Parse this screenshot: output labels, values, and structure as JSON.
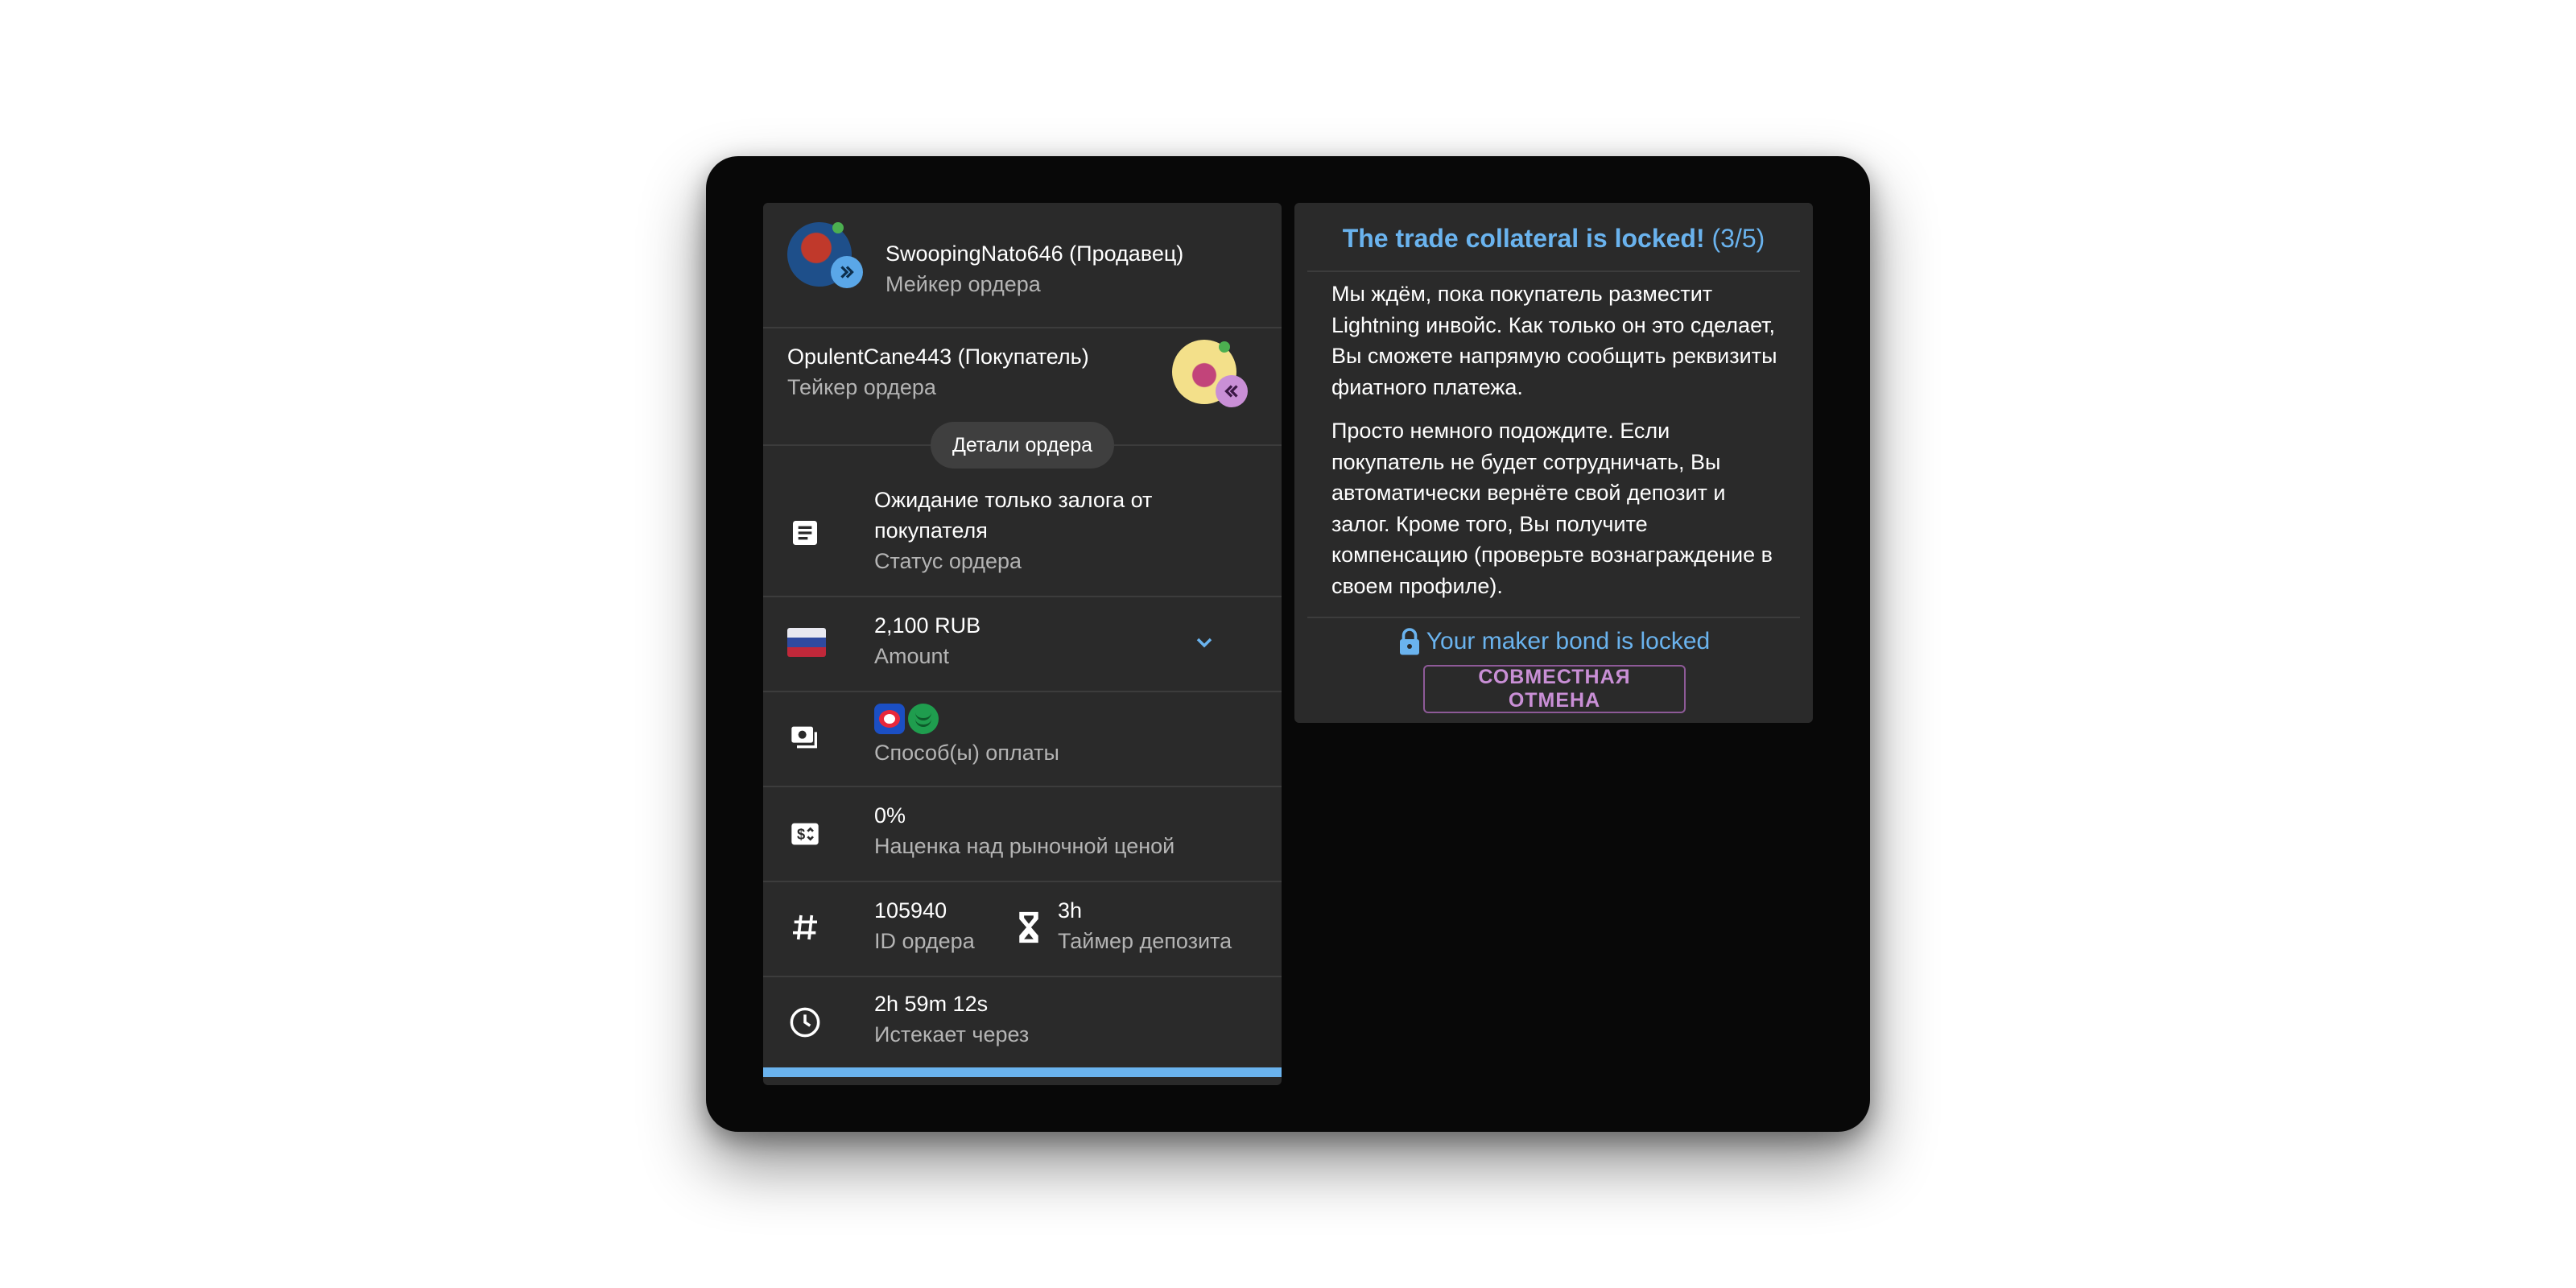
{
  "maker": {
    "name": "SwoopingNato646 (Продавец)",
    "role": "Мейкер ордера"
  },
  "taker": {
    "name": "OpulentCane443 (Покупатель)",
    "role": "Тейкер ордера"
  },
  "details_chip": "Детали ордера",
  "rows": {
    "status": {
      "value": "Ожидание только залога от покупателя",
      "label": "Статус ордера",
      "icon": "article-icon"
    },
    "amount": {
      "value": "2,100 RUB",
      "label": "Amount",
      "icon": "russia-flag-icon"
    },
    "payment": {
      "label": "Способ(ы) оплаты",
      "methods": [
        "bank-icon-red",
        "bank-icon-green"
      ]
    },
    "premium": {
      "value": "0%",
      "label": "Наценка над рыночной ценой",
      "icon": "price-change-icon"
    },
    "order_id": {
      "value": "105940",
      "label": "ID ордера",
      "icon": "hash-icon"
    },
    "deposit_timer": {
      "value": "3h",
      "label": "Таймер депозита",
      "icon": "hourglass-icon"
    },
    "expires": {
      "value": "2h 59m 12s",
      "label": "Истекает через",
      "icon": "clock-icon"
    }
  },
  "progress": {
    "fraction": 1.0
  },
  "status_panel": {
    "title": "The trade collateral is locked!",
    "step": "(3/5)",
    "para1": "Мы ждём, пока покупатель разместит Lightning инвойс. Как только он это сделает, Вы сможете напрямую сообщить реквизиты фиатного платежа.",
    "para2": "Просто немного подождите. Если покупатель не будет сотрудничать, Вы автоматически вернёте свой депозит и залог. Кроме того, Вы получите компенсацию (проверьте вознаграждение в своем профиле).",
    "bond_text": "Your maker bond is locked",
    "cancel_button": "СОВМЕСТНАЯ ОТМЕНА"
  },
  "colors": {
    "accent_blue": "#6ab3ee",
    "accent_purple": "#c98fd6",
    "panel_bg": "#2a2a2a",
    "online": "#4caf50"
  }
}
